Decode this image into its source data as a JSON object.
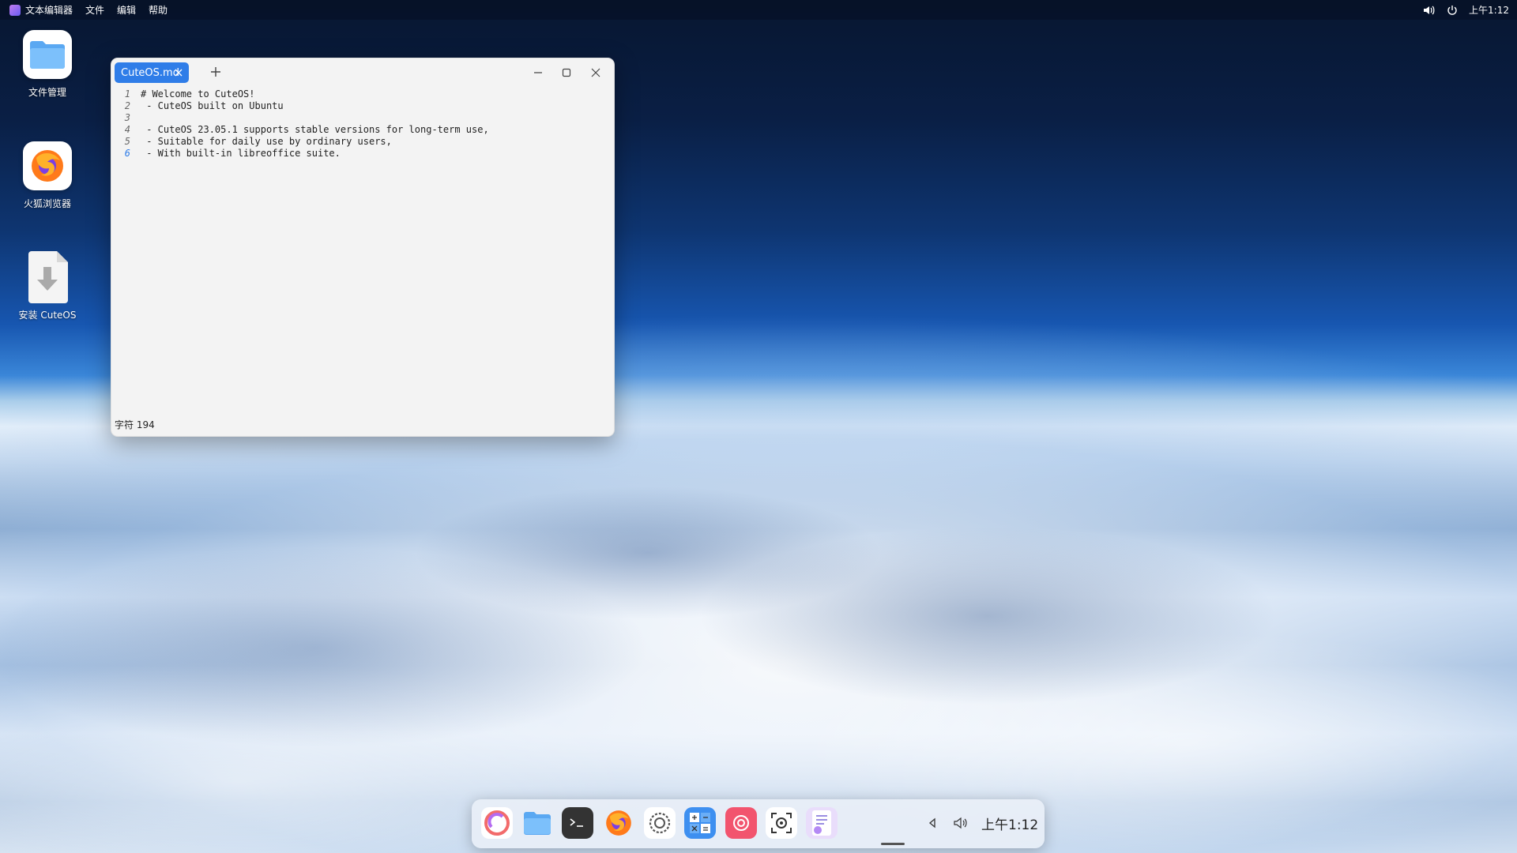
{
  "topbar": {
    "app_name": "文本编辑器",
    "menus": [
      "文件",
      "编辑",
      "帮助"
    ],
    "clock": "上午1:12",
    "tray_icons": [
      "volume-icon",
      "power-icon"
    ]
  },
  "desktop": {
    "icons": [
      {
        "label": "文件管理",
        "icon": "folder-icon"
      },
      {
        "label": "火狐浏览器",
        "icon": "firefox-icon"
      },
      {
        "label": "安装 CuteOS",
        "icon": "install-icon"
      }
    ]
  },
  "editor": {
    "tab_title": "CuteOS.md",
    "lines": [
      {
        "num": "1",
        "text": "# Welcome to CuteOS!"
      },
      {
        "num": "2",
        "text": " - CuteOS built on Ubuntu"
      },
      {
        "num": "3",
        "text": ""
      },
      {
        "num": "4",
        "text": " - CuteOS 23.05.1 supports stable versions for long-term use,"
      },
      {
        "num": "5",
        "text": " - Suitable for daily use by ordinary users,"
      },
      {
        "num": "6",
        "text": " - With built-in libreoffice suite."
      }
    ],
    "current_line": 6,
    "status": "字符 194",
    "accent": "#2f7de8"
  },
  "dock": {
    "items": [
      "launcher-icon",
      "files-icon",
      "terminal-icon",
      "firefox-icon",
      "settings-icon",
      "calculator-icon",
      "screen-recorder-icon",
      "screenshot-icon",
      "text-editor-icon"
    ],
    "clock": "上午1:12",
    "tray_icons": [
      "chevron-left-icon",
      "volume-icon"
    ]
  }
}
